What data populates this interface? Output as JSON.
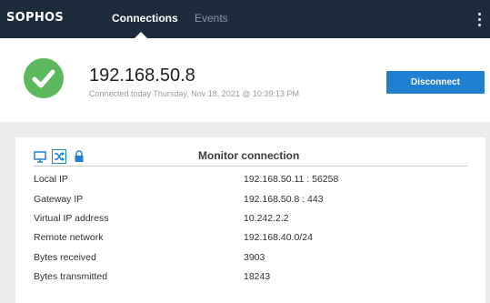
{
  "app": {
    "logo": "SOPHOS"
  },
  "nav": {
    "tabs": [
      {
        "label": "Connections",
        "active": true
      },
      {
        "label": "Events",
        "active": false
      }
    ]
  },
  "connection": {
    "ip": "192.168.50.8",
    "connected_text": "Connected today Thursday, Nov 18, 2021 @ 10:39:13 PM",
    "status": "connected",
    "status_color": "#5cb85c",
    "disconnect_label": "Disconnect",
    "accent_color": "#1f80d1"
  },
  "monitor": {
    "title": "Monitor connection",
    "toolbar_icons": [
      "monitor-icon",
      "shuffle-icon",
      "lock-icon"
    ],
    "rows": [
      {
        "label": "Local IP",
        "value": "192.168.50.11 : 56258"
      },
      {
        "label": "Gateway IP",
        "value": "192.168.50.8 : 443"
      },
      {
        "label": "Virtual IP address",
        "value": "10.242.2.2"
      },
      {
        "label": "Remote network",
        "value": "192.168.40.0/24"
      },
      {
        "label": "Bytes received",
        "value": "3903"
      },
      {
        "label": "Bytes transmitted",
        "value": "18243"
      }
    ]
  }
}
